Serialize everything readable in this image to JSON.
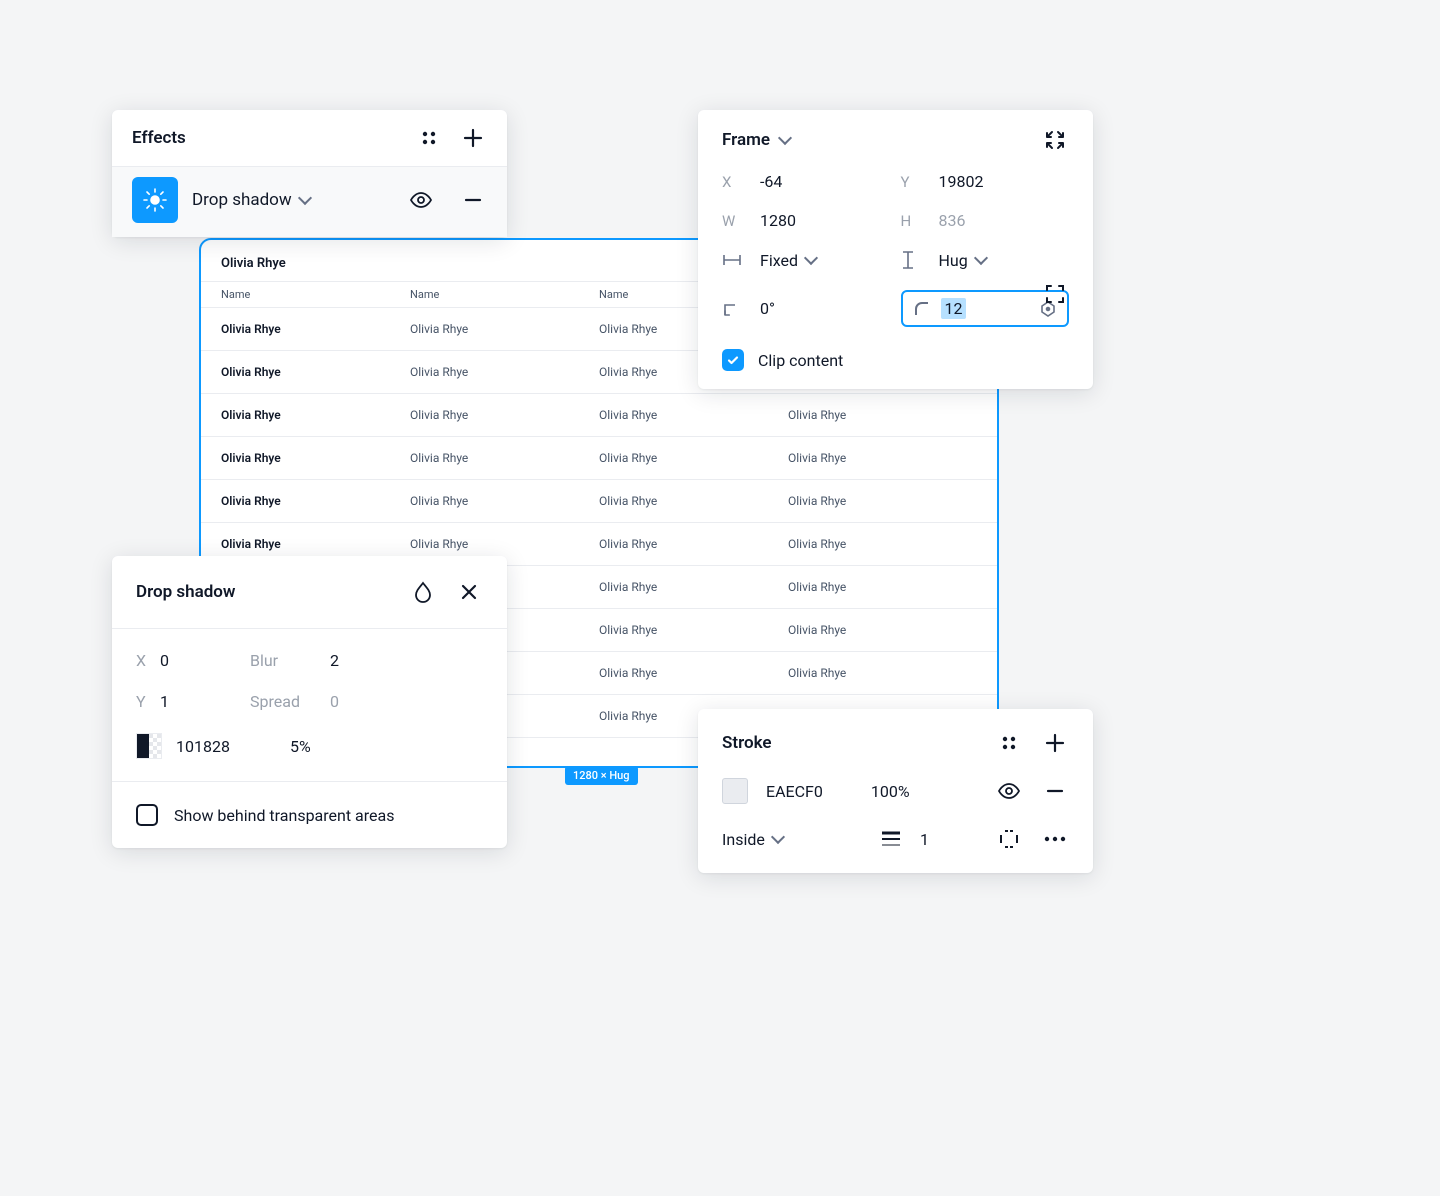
{
  "effects": {
    "title": "Effects",
    "selected": "Drop shadow"
  },
  "frame": {
    "title": "Frame",
    "x_label": "X",
    "x": "-64",
    "y_label": "Y",
    "y": "19802",
    "w_label": "W",
    "w": "1280",
    "h_label": "H",
    "h": "836",
    "hmode": "Fixed",
    "vmode": "Hug",
    "rotation": "0°",
    "radius": "12",
    "clip_label": "Clip content",
    "clip_checked": true
  },
  "drop_shadow": {
    "title": "Drop shadow",
    "x_label": "X",
    "x": "0",
    "y_label": "Y",
    "y": "1",
    "blur_label": "Blur",
    "blur": "2",
    "spread_label": "Spread",
    "spread": "0",
    "color_hex": "101828",
    "opacity": "5%",
    "show_behind_label": "Show behind transparent areas"
  },
  "stroke": {
    "title": "Stroke",
    "color_hex": "EAECF0",
    "opacity": "100%",
    "position": "Inside",
    "width": "1"
  },
  "canvas": {
    "frame_title": "Olivia Rhye",
    "col": "Name",
    "cell": "Olivia Rhye",
    "size_badge": "1280 × Hug"
  }
}
